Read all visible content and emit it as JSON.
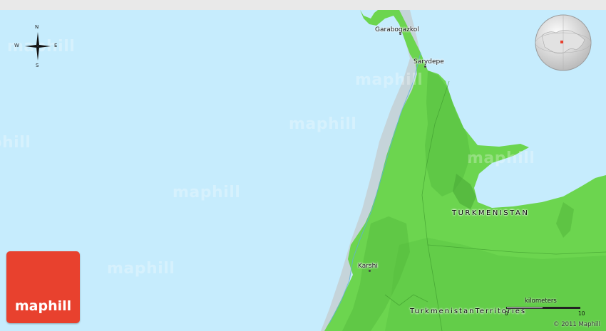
{
  "map": {
    "places": {
      "garabogazkol": "Garabogazkol",
      "sarydepe": "Sarydepe",
      "karshi": "Karshi"
    },
    "country_label": "TURKMENISTAN",
    "territory_label": "TurkmenistanTerritories",
    "compass": {
      "n": "N",
      "s": "S",
      "e": "E",
      "w": "W"
    },
    "scale": {
      "unit": "kilometers",
      "start": "0",
      "end": "10"
    },
    "copyright": "© 2011 Maphill",
    "logo": "maphill",
    "watermark": "maphill",
    "colors": {
      "water": "#c6ecfd",
      "land": "#6cd54f",
      "land_shadow": "#4fb33a",
      "logo": "#e8412e"
    }
  }
}
